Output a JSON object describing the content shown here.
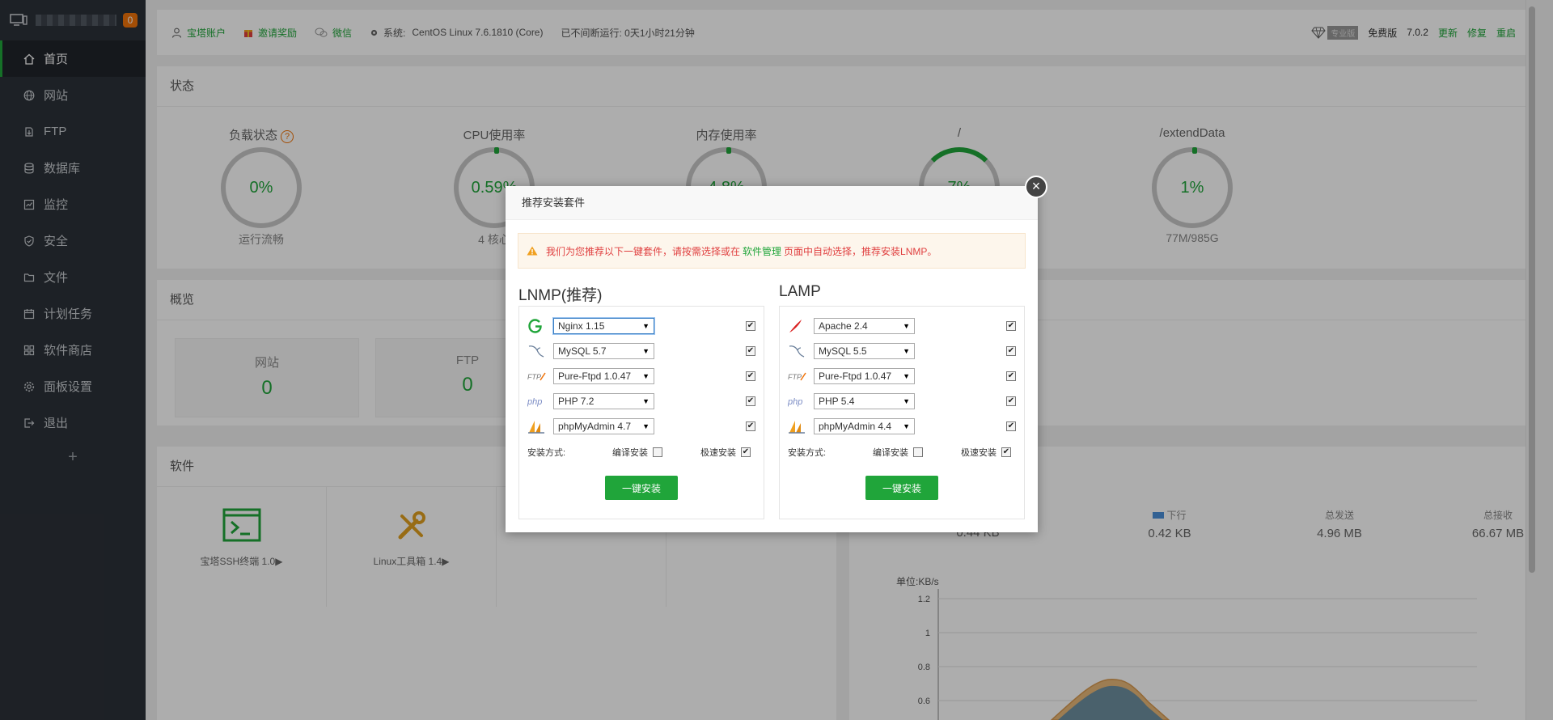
{
  "sidebar": {
    "badge": "0",
    "items": [
      {
        "label": "首页",
        "icon": "home-icon"
      },
      {
        "label": "网站",
        "icon": "globe-icon"
      },
      {
        "label": "FTP",
        "icon": "ftp-icon"
      },
      {
        "label": "数据库",
        "icon": "database-icon"
      },
      {
        "label": "监控",
        "icon": "monitor-icon"
      },
      {
        "label": "安全",
        "icon": "shield-icon"
      },
      {
        "label": "文件",
        "icon": "folder-icon"
      },
      {
        "label": "计划任务",
        "icon": "calendar-icon"
      },
      {
        "label": "软件商店",
        "icon": "apps-icon"
      },
      {
        "label": "面板设置",
        "icon": "gear-icon"
      },
      {
        "label": "退出",
        "icon": "logout-icon"
      }
    ],
    "add": "+"
  },
  "topbar": {
    "account": "宝塔账户",
    "invite": "邀请奖励",
    "wechat": "微信",
    "system_label": "系统:",
    "system_value": "CentOS Linux 7.6.1810 (Core)",
    "uptime": "已不间断运行: 0天1小时21分钟",
    "pro": "专业版",
    "edition": "免费版",
    "version": "7.0.2",
    "update": "更新",
    "repair": "修复",
    "restart": "重启"
  },
  "status": {
    "title": "状态",
    "gauges": [
      {
        "label": "负载状态",
        "value": "0%",
        "sub": "运行流畅"
      },
      {
        "label": "CPU使用率",
        "value": "0.59%",
        "sub": "4 核心"
      },
      {
        "label": "内存使用率",
        "value": "4.8%",
        "sub": ""
      },
      {
        "label": "/",
        "value": "7%",
        "sub": ""
      },
      {
        "label": "/extendData",
        "value": "1%",
        "sub": "77M/985G"
      }
    ]
  },
  "overview": {
    "title": "概览",
    "items": [
      {
        "label": "网站",
        "value": "0"
      },
      {
        "label": "FTP",
        "value": "0"
      }
    ]
  },
  "software": {
    "title": "软件",
    "items": [
      {
        "name": "宝塔SSH终端 1.0▶"
      },
      {
        "name": "Linux工具箱 1.4▶"
      }
    ]
  },
  "traffic": {
    "up_value": "0.44 KB",
    "down_label": "下行",
    "down_value": "0.42 KB",
    "sent_label": "总发送",
    "sent_value": "4.96 MB",
    "recv_label": "总接收",
    "recv_value": "66.67 MB",
    "unit": "单位:KB/s",
    "y_ticks": [
      "1.2",
      "1",
      "0.8",
      "0.6"
    ],
    "colors": {
      "down": "#4a90d9",
      "area_up": "#e8b87a",
      "area_down": "#6e8fa0"
    }
  },
  "modal": {
    "title": "推荐安装套件",
    "alert_pre": "我们为您推荐以下一键套件，请按需选择或在",
    "alert_link": "软件管理",
    "alert_post": "页面中自动选择，推荐安装LNMP。",
    "close": "×",
    "lnmp": {
      "title": "LNMP(推荐)",
      "rows": [
        {
          "icon": "nginx-icon",
          "selected": "Nginx 1.15"
        },
        {
          "icon": "mysql-icon",
          "selected": "MySQL 5.7"
        },
        {
          "icon": "ftp-icon",
          "selected": "Pure-Ftpd 1.0.47"
        },
        {
          "icon": "php-icon",
          "selected": "PHP 7.2"
        },
        {
          "icon": "phpmyadmin-icon",
          "selected": "phpMyAdmin 4.7"
        }
      ],
      "mode_label": "安装方式:",
      "compile": "编译安装",
      "fast": "极速安装",
      "button": "一键安装"
    },
    "lamp": {
      "title": "LAMP",
      "rows": [
        {
          "icon": "apache-icon",
          "selected": "Apache 2.4"
        },
        {
          "icon": "mysql-icon",
          "selected": "MySQL 5.5"
        },
        {
          "icon": "ftp-icon",
          "selected": "Pure-Ftpd 1.0.47"
        },
        {
          "icon": "php-icon",
          "selected": "PHP 5.4"
        },
        {
          "icon": "phpmyadmin-icon",
          "selected": "phpMyAdmin 4.4"
        }
      ],
      "mode_label": "安装方式:",
      "compile": "编译安装",
      "fast": "极速安装",
      "button": "一键安装"
    },
    "check_mark": "✔"
  },
  "colors": {
    "accent": "#20a53a",
    "sidebar": "#2c3138",
    "warn": "#f0730a",
    "alert_text": "#e04040"
  }
}
